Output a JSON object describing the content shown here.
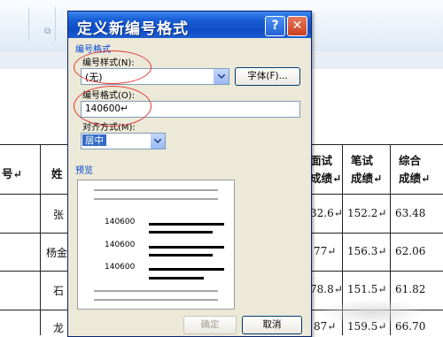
{
  "dialog": {
    "title": "定义新编号格式",
    "help_label": "?",
    "close_label": "✕",
    "group_label": "编号格式",
    "style_label": "编号样式(N):",
    "style_value": "(无)",
    "font_button": "字体(F)...",
    "format_label": "编号格式(O):",
    "format_value": "140600↵",
    "align_label": "对齐方式(M):",
    "align_value": "居中",
    "preview_label": "预览",
    "preview_number": "140600",
    "ok_button": "确定",
    "cancel_button": "取消"
  },
  "background_table": {
    "header_left": [
      "号↵",
      "姓"
    ],
    "headers": [
      "面试\n成绩↵",
      "笔试\n成绩↵",
      "综合\n成绩↵"
    ],
    "row_names": [
      "张",
      "杨金",
      "石",
      "龙"
    ],
    "rows": [
      [
        "32.6↵",
        "152.2↵",
        "63.48"
      ],
      [
        "77↵",
        "156.3↵",
        "62.06"
      ],
      [
        "78.8↵",
        "151.5↵",
        "61.82"
      ],
      [
        "87↵",
        "159.5↵",
        "66.70"
      ]
    ]
  },
  "colors": {
    "titlebar": "#0f4cc5",
    "dialog_bg": "#ece9d8",
    "highlight_ellipse": "#e03a3a",
    "selection": "#316ac5"
  }
}
